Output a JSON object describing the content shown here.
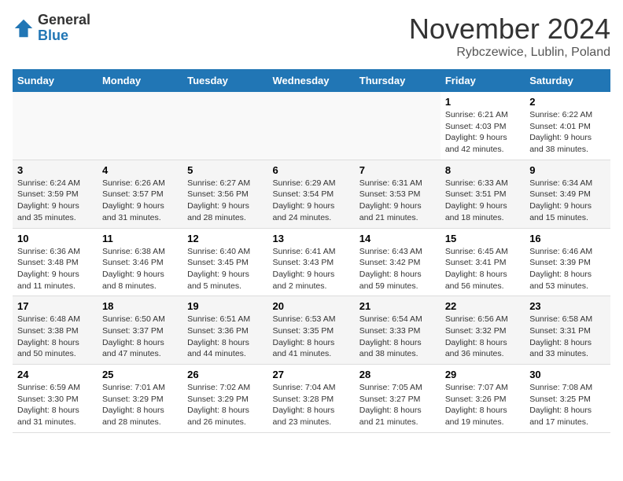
{
  "header": {
    "logo_general": "General",
    "logo_blue": "Blue",
    "month_title": "November 2024",
    "location": "Rybczewice, Lublin, Poland"
  },
  "weekdays": [
    "Sunday",
    "Monday",
    "Tuesday",
    "Wednesday",
    "Thursday",
    "Friday",
    "Saturday"
  ],
  "weeks": [
    [
      {
        "day": "",
        "info": ""
      },
      {
        "day": "",
        "info": ""
      },
      {
        "day": "",
        "info": ""
      },
      {
        "day": "",
        "info": ""
      },
      {
        "day": "",
        "info": ""
      },
      {
        "day": "1",
        "info": "Sunrise: 6:21 AM\nSunset: 4:03 PM\nDaylight: 9 hours and 42 minutes."
      },
      {
        "day": "2",
        "info": "Sunrise: 6:22 AM\nSunset: 4:01 PM\nDaylight: 9 hours and 38 minutes."
      }
    ],
    [
      {
        "day": "3",
        "info": "Sunrise: 6:24 AM\nSunset: 3:59 PM\nDaylight: 9 hours and 35 minutes."
      },
      {
        "day": "4",
        "info": "Sunrise: 6:26 AM\nSunset: 3:57 PM\nDaylight: 9 hours and 31 minutes."
      },
      {
        "day": "5",
        "info": "Sunrise: 6:27 AM\nSunset: 3:56 PM\nDaylight: 9 hours and 28 minutes."
      },
      {
        "day": "6",
        "info": "Sunrise: 6:29 AM\nSunset: 3:54 PM\nDaylight: 9 hours and 24 minutes."
      },
      {
        "day": "7",
        "info": "Sunrise: 6:31 AM\nSunset: 3:53 PM\nDaylight: 9 hours and 21 minutes."
      },
      {
        "day": "8",
        "info": "Sunrise: 6:33 AM\nSunset: 3:51 PM\nDaylight: 9 hours and 18 minutes."
      },
      {
        "day": "9",
        "info": "Sunrise: 6:34 AM\nSunset: 3:49 PM\nDaylight: 9 hours and 15 minutes."
      }
    ],
    [
      {
        "day": "10",
        "info": "Sunrise: 6:36 AM\nSunset: 3:48 PM\nDaylight: 9 hours and 11 minutes."
      },
      {
        "day": "11",
        "info": "Sunrise: 6:38 AM\nSunset: 3:46 PM\nDaylight: 9 hours and 8 minutes."
      },
      {
        "day": "12",
        "info": "Sunrise: 6:40 AM\nSunset: 3:45 PM\nDaylight: 9 hours and 5 minutes."
      },
      {
        "day": "13",
        "info": "Sunrise: 6:41 AM\nSunset: 3:43 PM\nDaylight: 9 hours and 2 minutes."
      },
      {
        "day": "14",
        "info": "Sunrise: 6:43 AM\nSunset: 3:42 PM\nDaylight: 8 hours and 59 minutes."
      },
      {
        "day": "15",
        "info": "Sunrise: 6:45 AM\nSunset: 3:41 PM\nDaylight: 8 hours and 56 minutes."
      },
      {
        "day": "16",
        "info": "Sunrise: 6:46 AM\nSunset: 3:39 PM\nDaylight: 8 hours and 53 minutes."
      }
    ],
    [
      {
        "day": "17",
        "info": "Sunrise: 6:48 AM\nSunset: 3:38 PM\nDaylight: 8 hours and 50 minutes."
      },
      {
        "day": "18",
        "info": "Sunrise: 6:50 AM\nSunset: 3:37 PM\nDaylight: 8 hours and 47 minutes."
      },
      {
        "day": "19",
        "info": "Sunrise: 6:51 AM\nSunset: 3:36 PM\nDaylight: 8 hours and 44 minutes."
      },
      {
        "day": "20",
        "info": "Sunrise: 6:53 AM\nSunset: 3:35 PM\nDaylight: 8 hours and 41 minutes."
      },
      {
        "day": "21",
        "info": "Sunrise: 6:54 AM\nSunset: 3:33 PM\nDaylight: 8 hours and 38 minutes."
      },
      {
        "day": "22",
        "info": "Sunrise: 6:56 AM\nSunset: 3:32 PM\nDaylight: 8 hours and 36 minutes."
      },
      {
        "day": "23",
        "info": "Sunrise: 6:58 AM\nSunset: 3:31 PM\nDaylight: 8 hours and 33 minutes."
      }
    ],
    [
      {
        "day": "24",
        "info": "Sunrise: 6:59 AM\nSunset: 3:30 PM\nDaylight: 8 hours and 31 minutes."
      },
      {
        "day": "25",
        "info": "Sunrise: 7:01 AM\nSunset: 3:29 PM\nDaylight: 8 hours and 28 minutes."
      },
      {
        "day": "26",
        "info": "Sunrise: 7:02 AM\nSunset: 3:29 PM\nDaylight: 8 hours and 26 minutes."
      },
      {
        "day": "27",
        "info": "Sunrise: 7:04 AM\nSunset: 3:28 PM\nDaylight: 8 hours and 23 minutes."
      },
      {
        "day": "28",
        "info": "Sunrise: 7:05 AM\nSunset: 3:27 PM\nDaylight: 8 hours and 21 minutes."
      },
      {
        "day": "29",
        "info": "Sunrise: 7:07 AM\nSunset: 3:26 PM\nDaylight: 8 hours and 19 minutes."
      },
      {
        "day": "30",
        "info": "Sunrise: 7:08 AM\nSunset: 3:25 PM\nDaylight: 8 hours and 17 minutes."
      }
    ]
  ]
}
